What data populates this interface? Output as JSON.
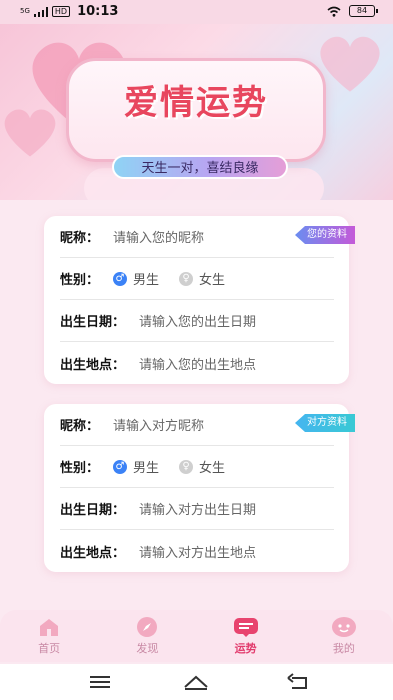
{
  "status_bar": {
    "signal": "5G",
    "network_badge": "HD",
    "time": "10:13",
    "battery": "84"
  },
  "banner": {
    "title": "爱情运势",
    "subtitle": "天生一对，喜结良缘"
  },
  "my_info": {
    "tag": "您的资料",
    "nickname_label": "昵称：",
    "nickname_placeholder": "请输入您的昵称",
    "gender_label": "性别：",
    "gender_male": "男生",
    "gender_female": "女生",
    "birthdate_label": "出生日期：",
    "birthdate_placeholder": "请输入您的出生日期",
    "birthplace_label": "出生地点：",
    "birthplace_placeholder": "请输入您的出生地点"
  },
  "partner_info": {
    "tag": "对方资料",
    "nickname_label": "昵称：",
    "nickname_placeholder": "请输入对方昵称",
    "gender_label": "性别：",
    "gender_male": "男生",
    "gender_female": "女生",
    "birthdate_label": "出生日期：",
    "birthdate_placeholder": "请输入对方出生日期",
    "birthplace_label": "出生地点：",
    "birthplace_placeholder": "请输入对方出生地点"
  },
  "tabbar": {
    "items": [
      {
        "label": "首页",
        "icon": "home-icon"
      },
      {
        "label": "发现",
        "icon": "compass-icon"
      },
      {
        "label": "运势",
        "icon": "fortune-icon",
        "active": true
      },
      {
        "label": "我的",
        "icon": "profile-icon"
      }
    ]
  },
  "colors": {
    "accent": "#e23b6d",
    "title_red": "#e8465e",
    "background": "#fbe9f1"
  }
}
